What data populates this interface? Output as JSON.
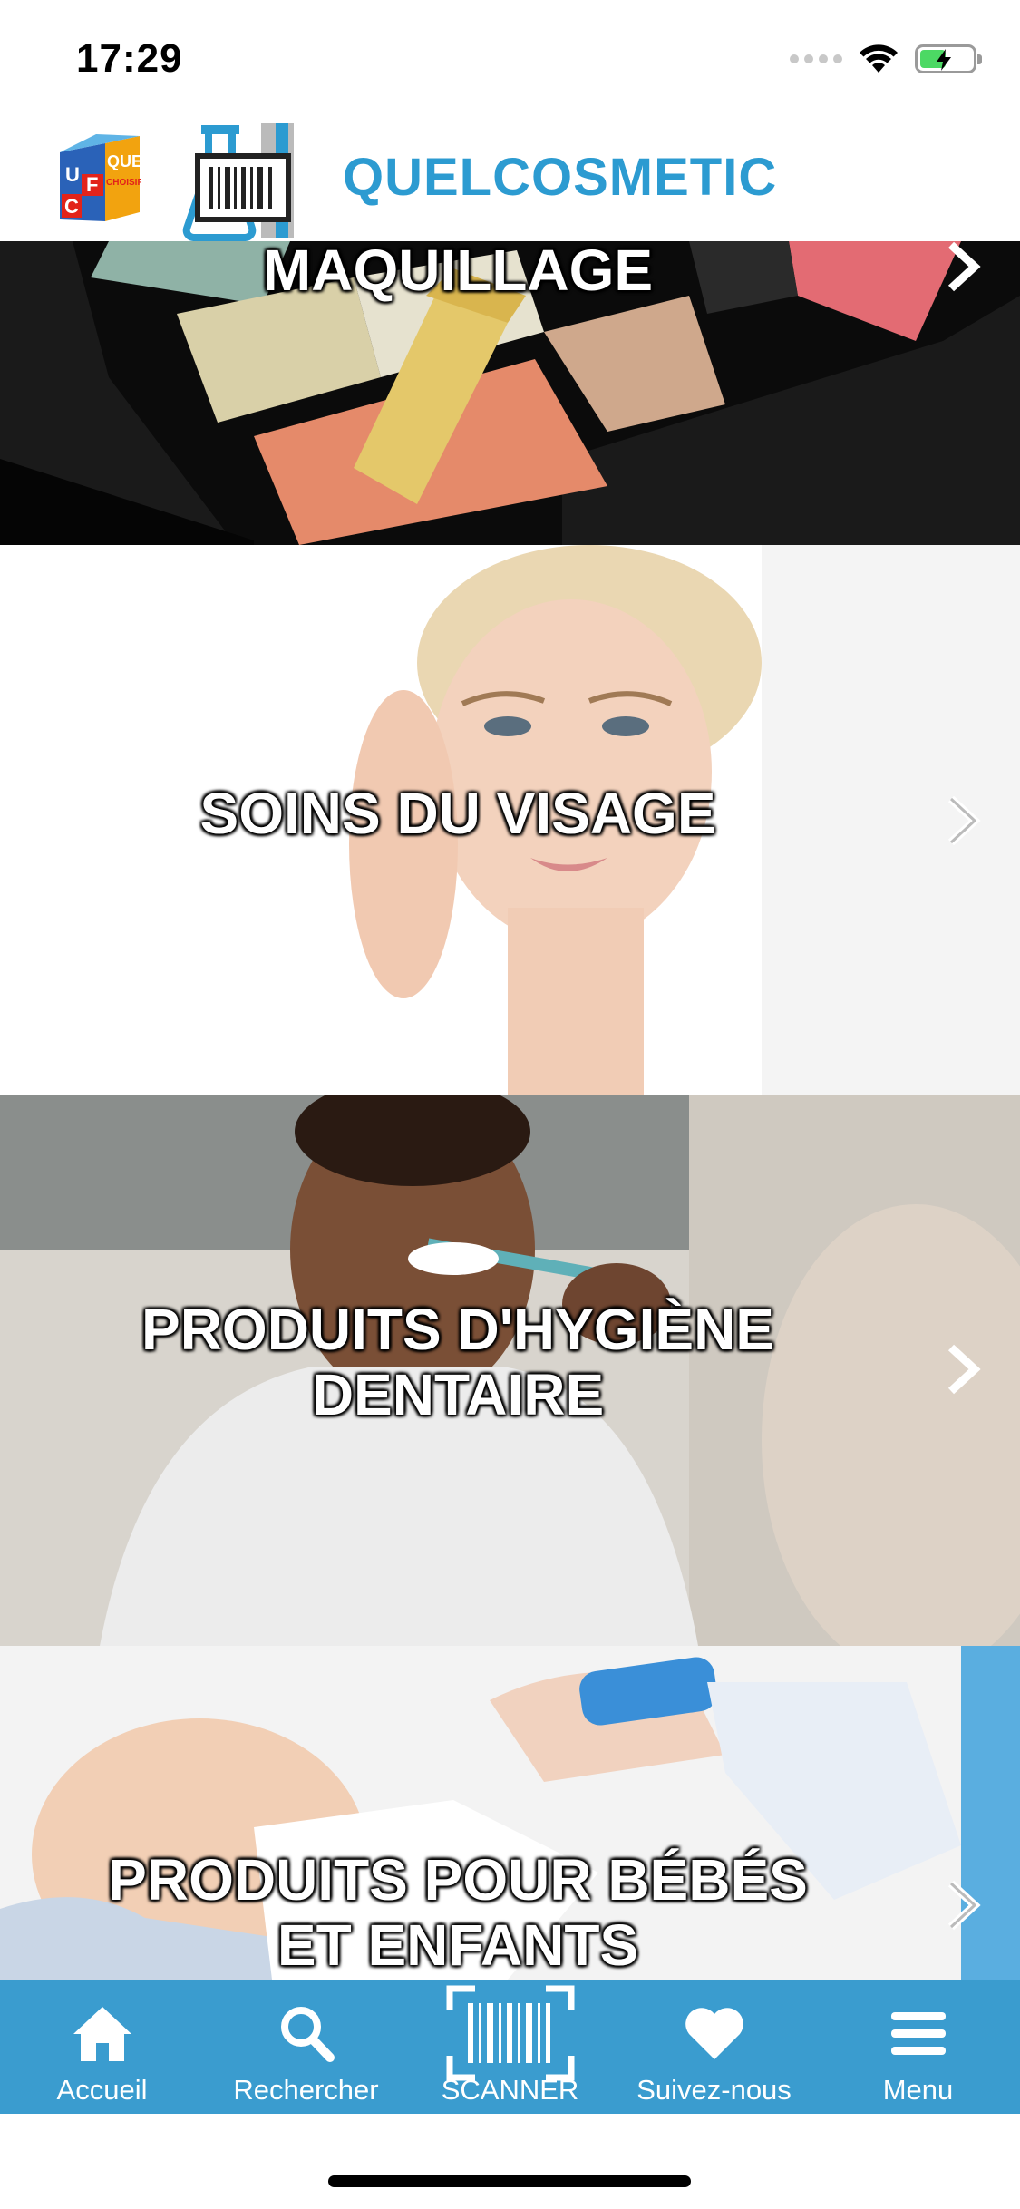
{
  "status_bar": {
    "time": "17:29"
  },
  "header": {
    "title": "QUELCOSMETIC",
    "ufc_logo": {
      "letters": [
        "U",
        "F",
        "C"
      ],
      "text_que": "QUE",
      "text_choisir": "CHOISIR"
    },
    "brand_color": "#2c9bd1"
  },
  "categories": [
    {
      "label_lines": [
        "MAQUILLAGE"
      ],
      "image": "makeup-palette"
    },
    {
      "label_lines": [
        "SOINS DU VISAGE"
      ],
      "image": "face-care-woman"
    },
    {
      "label_lines": [
        "PRODUITS D'HYGIÈNE",
        "DENTAIRE"
      ],
      "image": "man-brushing-teeth"
    },
    {
      "label_lines": [
        "PRODUITS POUR BÉBÉS",
        "ET ENFANTS"
      ],
      "image": "baby-care"
    }
  ],
  "tab_bar": {
    "background": "#3a9ccf",
    "tabs": [
      {
        "label": "Accueil",
        "icon": "home-icon"
      },
      {
        "label": "Rechercher",
        "icon": "search-icon"
      },
      {
        "label": "SCANNER",
        "icon": "barcode-scan-icon"
      },
      {
        "label": "Suivez-nous",
        "icon": "heart-icon"
      },
      {
        "label": "Menu",
        "icon": "hamburger-icon"
      }
    ]
  }
}
